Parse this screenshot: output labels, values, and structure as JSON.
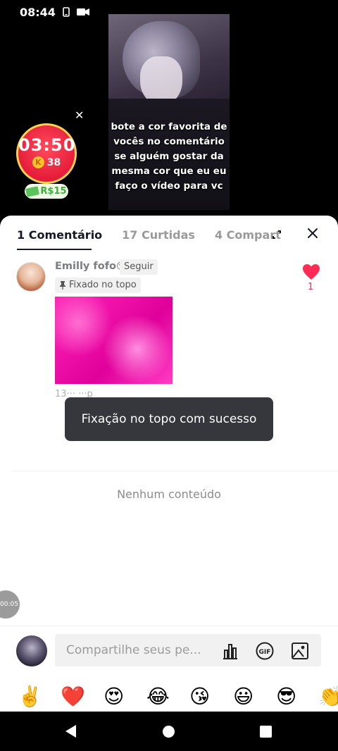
{
  "status_bar": {
    "time": "08:44",
    "icons": [
      "phone-icon",
      "video-camera-icon"
    ]
  },
  "video": {
    "caption": "bote a cor favorita de\nvocês no comentário\nse alguém gostar da\nmesma cor que eu eu\nfaço o vídeo para vc"
  },
  "timer": {
    "time": "03:50",
    "coins": "38",
    "coin_letter": "K",
    "reward": "R$15"
  },
  "sheet": {
    "tabs": [
      {
        "label": "1 Comentário",
        "active": true
      },
      {
        "label": "17 Curtidas",
        "active": false
      },
      {
        "label": "4 Compart",
        "active": false
      }
    ]
  },
  "comment": {
    "username": "Emilly fofo",
    "username_emoji": "😚",
    "follow_label": "Seguir",
    "pinned_label": "Fixado no topo",
    "meta": "13··· ···p",
    "likes": "1",
    "image_color": "#ff25b8"
  },
  "toast": {
    "message": "Fixação no topo com sucesso"
  },
  "empty": {
    "message": "Nenhum conteúdo"
  },
  "video_progress": {
    "label": "00:05"
  },
  "composer": {
    "placeholder": "Compartilhe seus pe..."
  },
  "emoji_bar": [
    "✌️",
    "❤️",
    "😍",
    "😂",
    "😘",
    "😃",
    "😎",
    "👏"
  ],
  "colors": {
    "accent": "#fe2c55",
    "toast_bg": "#36373d",
    "timer_bg": "#e51d3a",
    "timer_border": "#ffd24d"
  }
}
